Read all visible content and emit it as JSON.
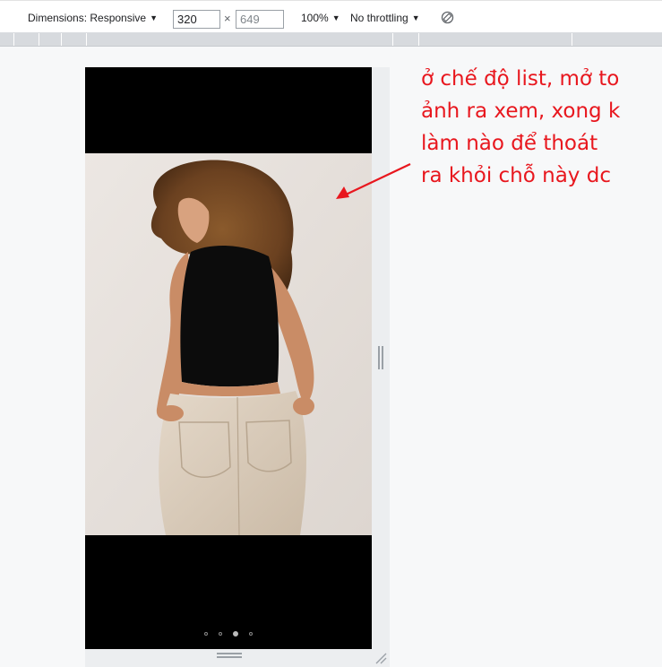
{
  "toolbar": {
    "dimensions_label": "Dimensions: Responsive",
    "width_value": "320",
    "times": "×",
    "height_value": "649",
    "zoom_label": "100%",
    "throttling_label": "No throttling",
    "rotate_icon": "rotate-icon"
  },
  "carousel": {
    "dot_count": 4,
    "active_index": 2
  },
  "annotation": {
    "lines": [
      "ở chế độ list, mở to",
      "ảnh ra xem, xong k",
      "làm nào để thoát",
      "ra khỏi chỗ này dc"
    ],
    "color": "#e8171e"
  }
}
